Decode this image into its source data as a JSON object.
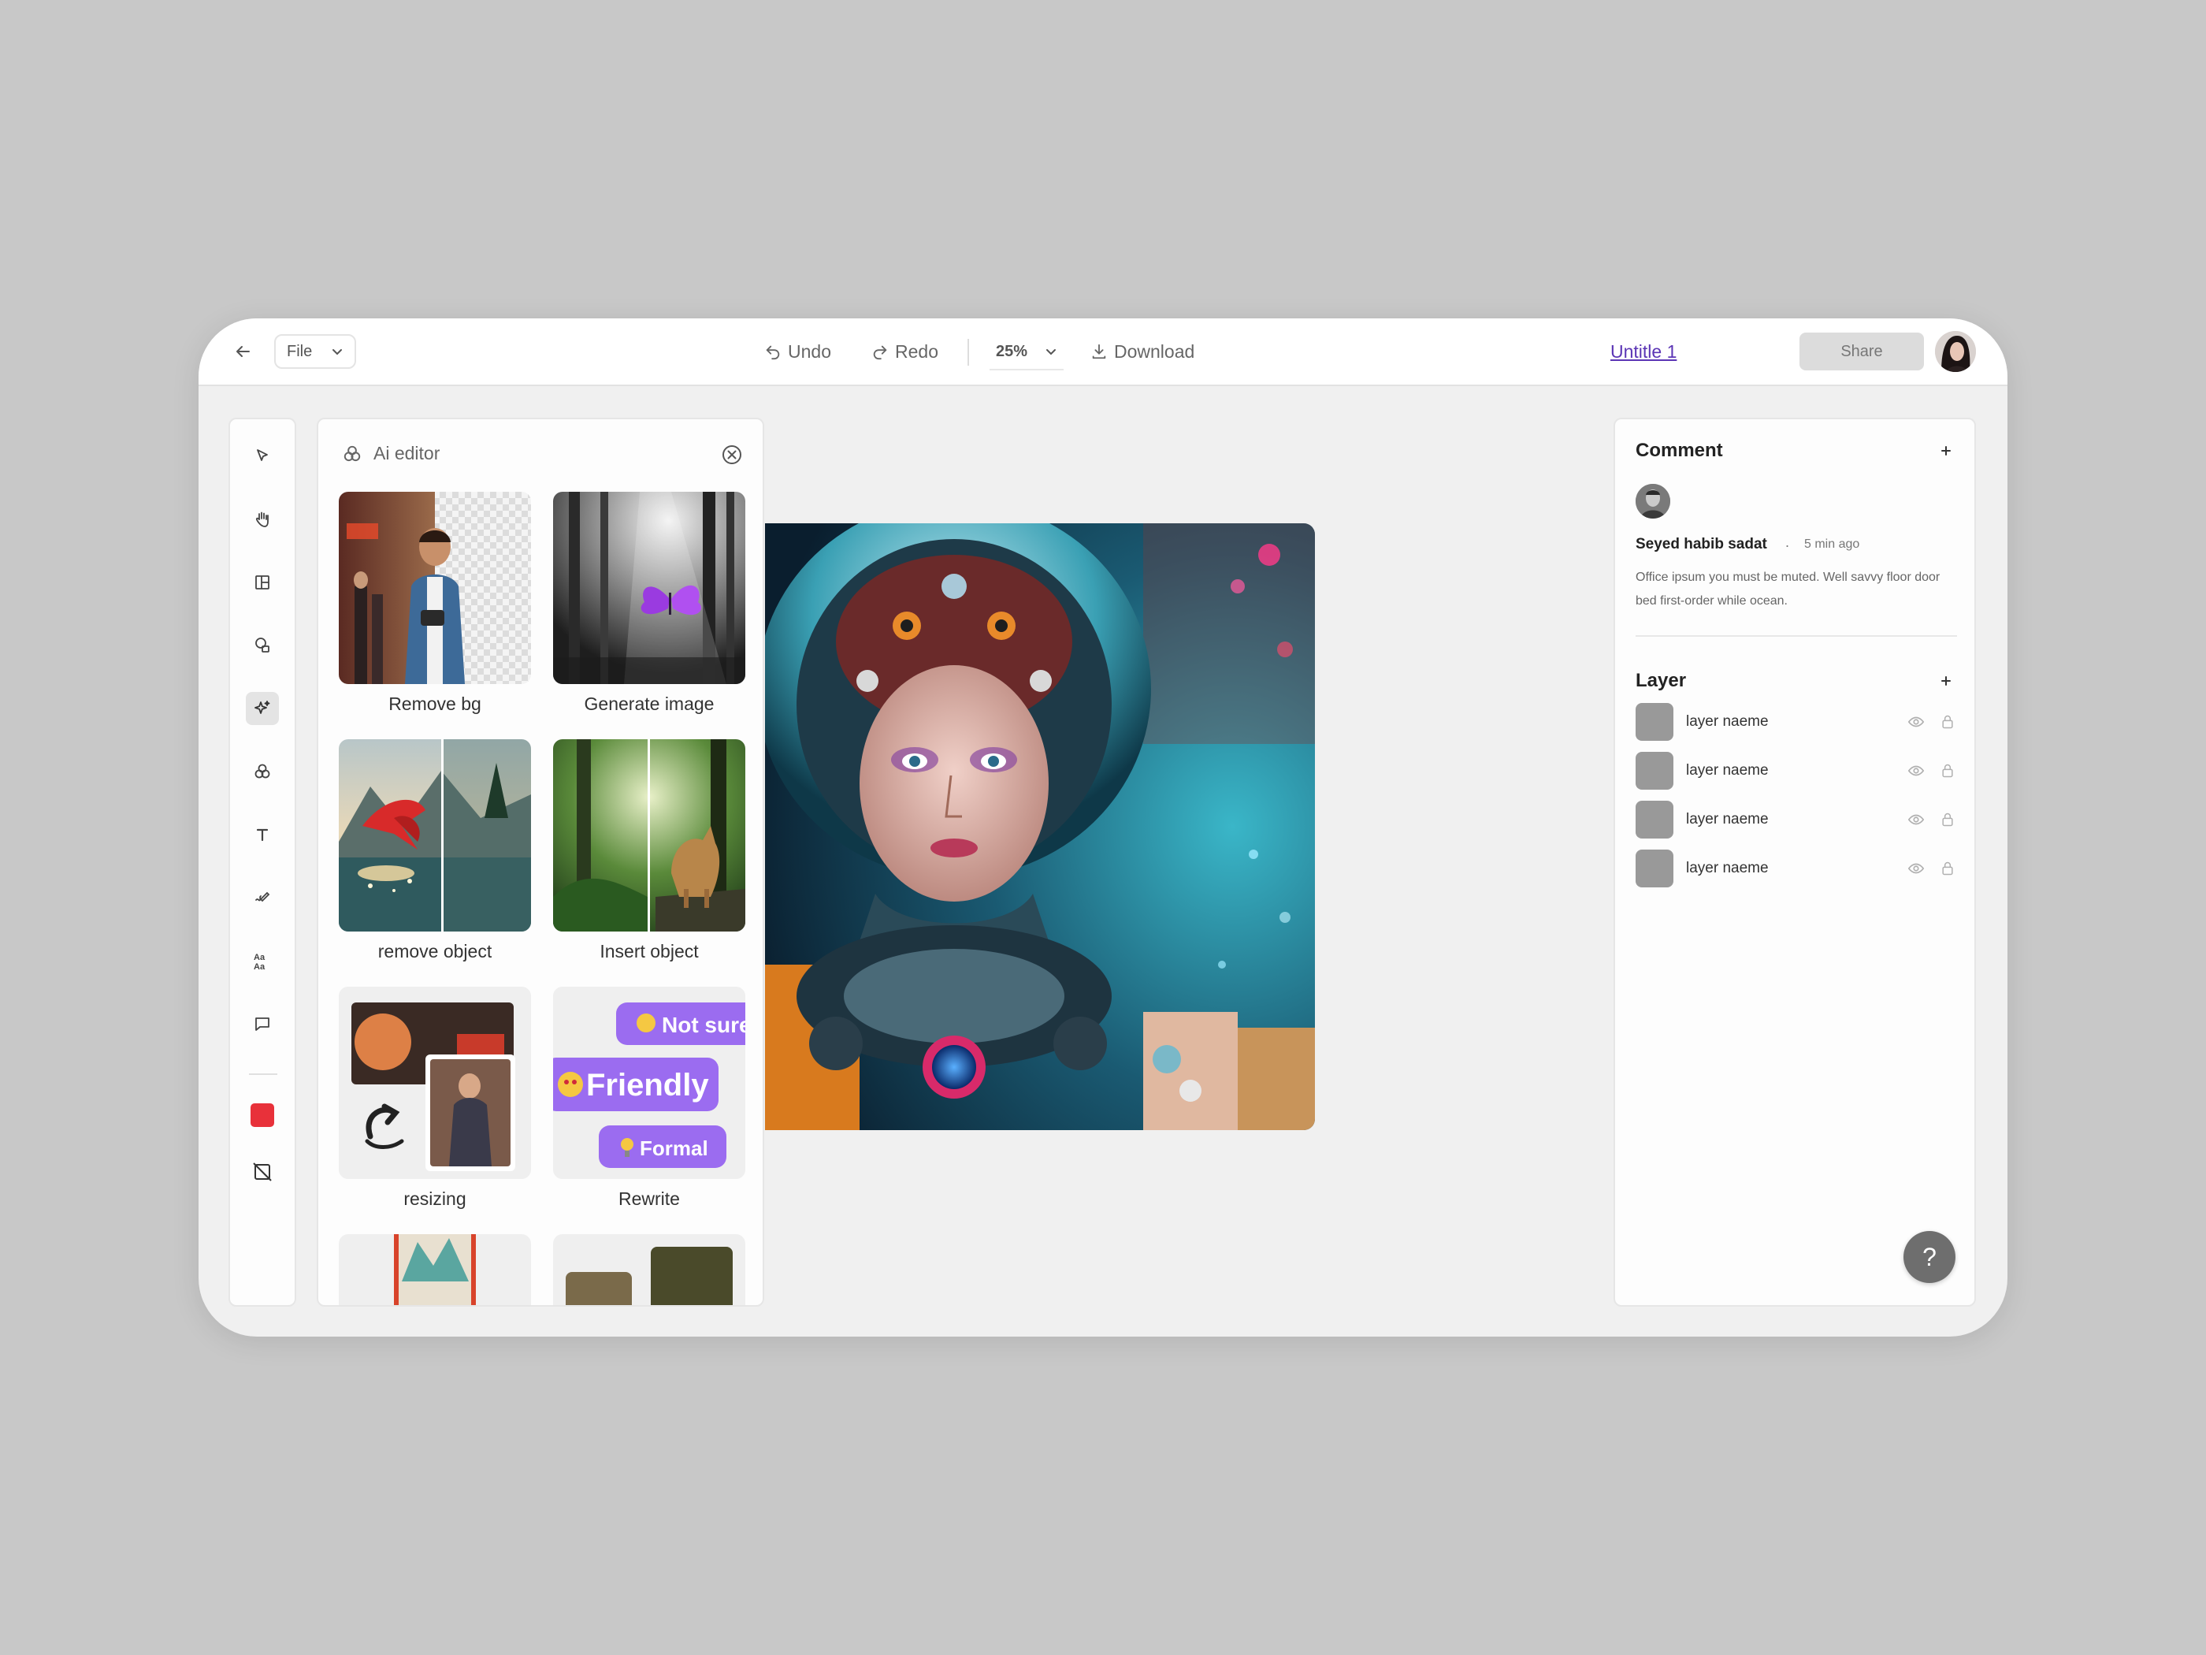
{
  "topbar": {
    "file_label": "File",
    "undo_label": "Undo",
    "redo_label": "Redo",
    "zoom_label": "25%",
    "download_label": "Download",
    "document_title": "Untitle 1",
    "share_label": "Share"
  },
  "toolbar": {
    "tools": [
      "select-pointer",
      "hand-pan",
      "layout-panel",
      "shapes",
      "ai-magic",
      "ai-editor",
      "text",
      "draw",
      "font-style",
      "comment"
    ],
    "active_tool": "ai-magic",
    "fill_color": "#E8313A"
  },
  "ai_editor": {
    "title": "Ai editor",
    "cards": [
      {
        "label": "Remove bg"
      },
      {
        "label": "Generate image"
      },
      {
        "label": "remove object"
      },
      {
        "label": "Insert object"
      },
      {
        "label": "resizing"
      },
      {
        "label": "Rewrite"
      }
    ],
    "rewrite_chips": [
      "Not sure",
      "Friendly",
      "Formal"
    ]
  },
  "comments": {
    "title": "Comment",
    "items": [
      {
        "author": "Seyed habib sadat",
        "separator": ".",
        "time": "5 min ago",
        "body": "Office ipsum you must be muted. Well savvy floor door bed first-order while ocean."
      }
    ]
  },
  "layers": {
    "title": "Layer",
    "items": [
      {
        "name": "layer naeme"
      },
      {
        "name": "layer naeme"
      },
      {
        "name": "layer naeme"
      },
      {
        "name": "layer naeme"
      }
    ]
  },
  "help": {
    "label": "?"
  },
  "colors": {
    "accent": "#5B35B5",
    "chip_purple": "#9B6CF0",
    "swatch_red": "#E8313A"
  }
}
